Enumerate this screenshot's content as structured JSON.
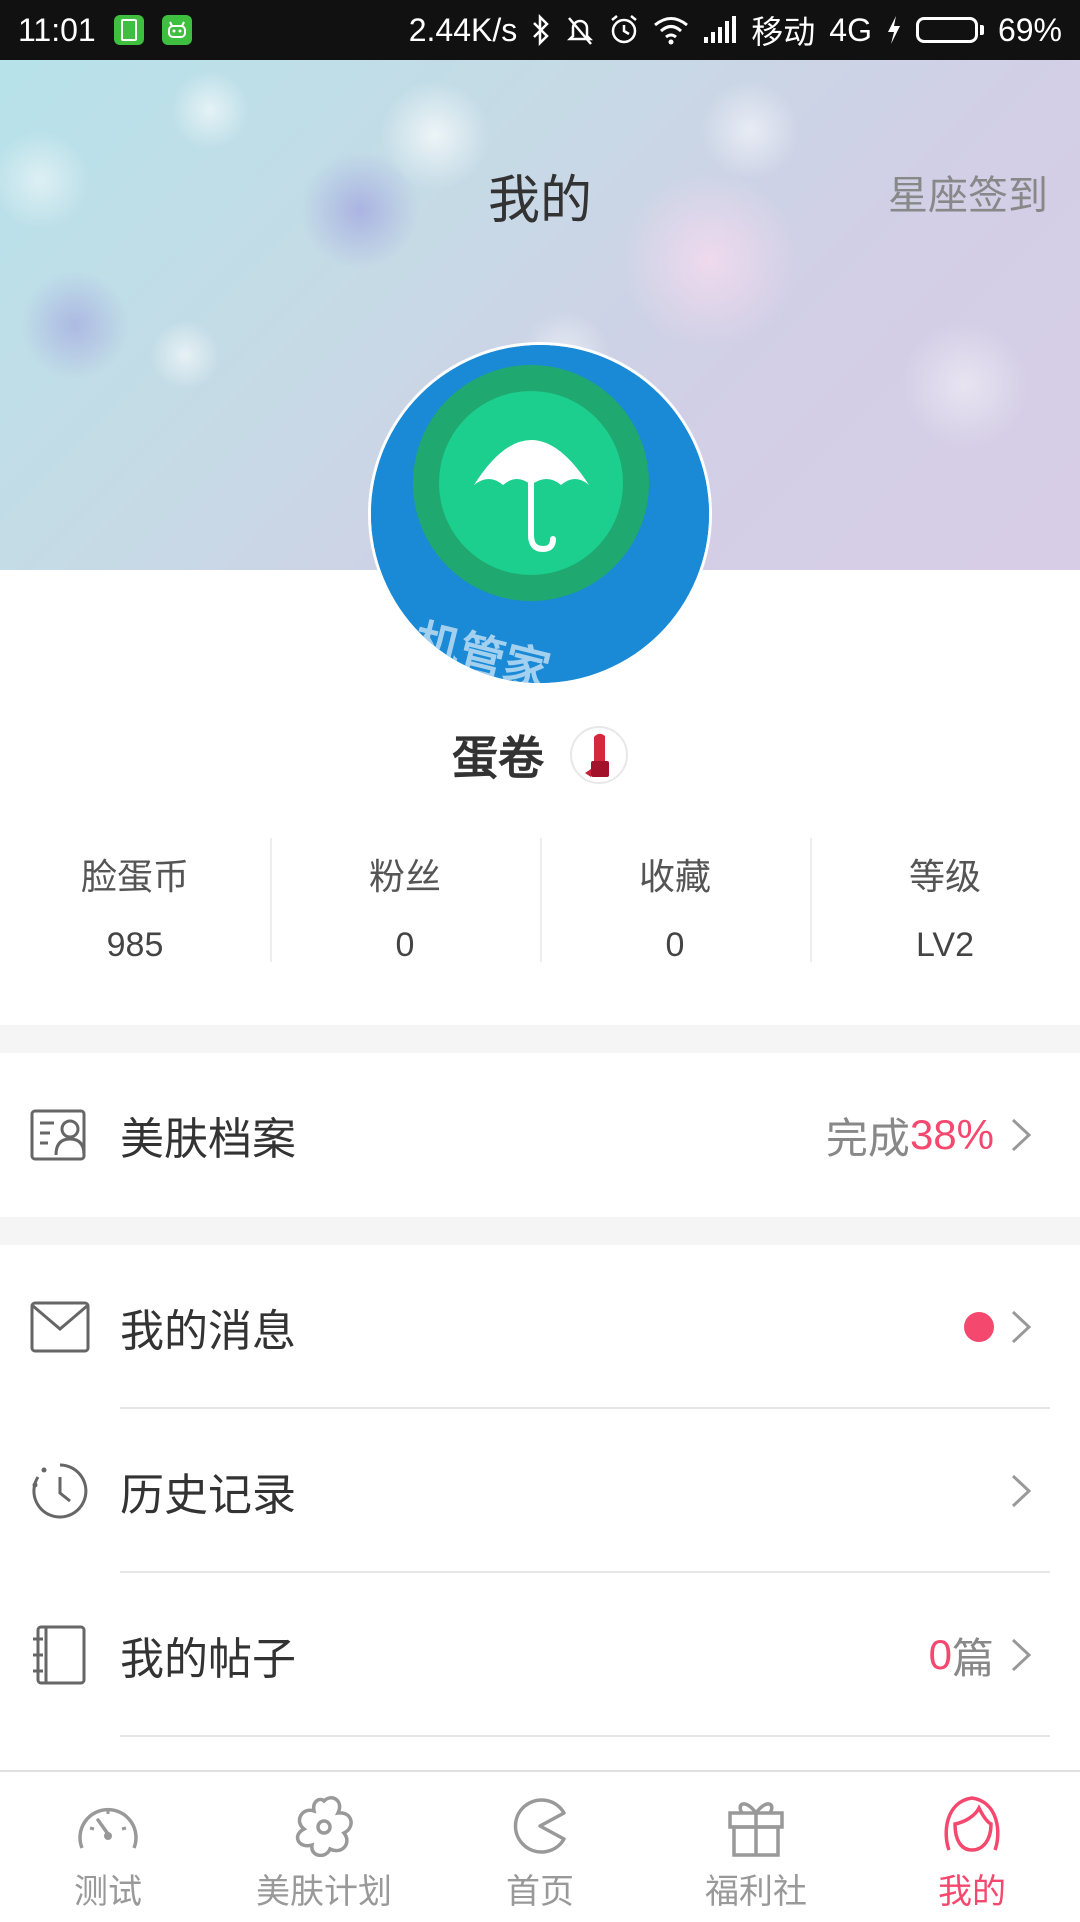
{
  "status_bar": {
    "time": "11:01",
    "speed": "2.44K/s",
    "carrier": "移动",
    "network": "4G",
    "battery": "69%",
    "battery_level": 0.69,
    "icons": [
      "battery-app-icon",
      "android-app-icon",
      "bluetooth-icon",
      "mute-icon",
      "alarm-icon",
      "wifi-icon",
      "signal-icon",
      "charging-icon"
    ]
  },
  "header": {
    "title": "我的",
    "sign_in": "星座签到"
  },
  "profile": {
    "username": "蛋卷",
    "avatar_icon": "umbrella-icon",
    "badge_icon": "lipstick-icon"
  },
  "stats": [
    {
      "label": "脸蛋币",
      "value": "985"
    },
    {
      "label": "粉丝",
      "value": "0"
    },
    {
      "label": "收藏",
      "value": "0"
    },
    {
      "label": "等级",
      "value": "LV2"
    }
  ],
  "menu": {
    "skin_profile": {
      "label": "美肤档案",
      "progress_text": "完成",
      "progress_value": "38%",
      "icon": "profile-card-icon"
    },
    "messages": {
      "label": "我的消息",
      "icon": "envelope-icon",
      "has_unread": true
    },
    "history": {
      "label": "历史记录",
      "icon": "history-icon"
    },
    "posts": {
      "label": "我的帖子",
      "count": "0",
      "unit": "篇",
      "icon": "notebook-icon"
    }
  },
  "bottom_nav": [
    {
      "label": "测试",
      "icon": "speedometer-icon",
      "active": false
    },
    {
      "label": "美肤计划",
      "icon": "flower-icon",
      "active": false
    },
    {
      "label": "首页",
      "icon": "pacman-icon",
      "active": false
    },
    {
      "label": "福利社",
      "icon": "gift-icon",
      "active": false
    },
    {
      "label": "我的",
      "icon": "girl-face-icon",
      "active": true
    }
  ],
  "colors": {
    "accent": "#f5486e",
    "status_bar": "#111111",
    "battery": "#5ad247"
  }
}
